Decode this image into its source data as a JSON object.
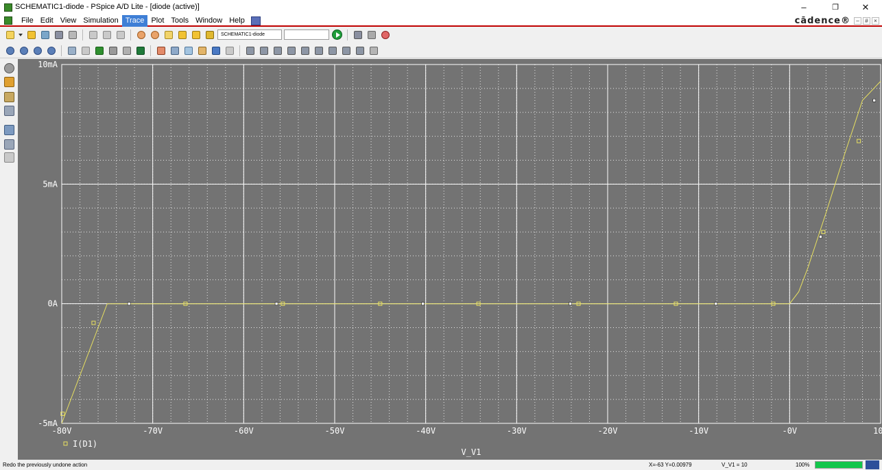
{
  "window": {
    "title": "SCHEMATIC1-diode - PSpice A/D Lite - [diode (active)]",
    "min_label": "–",
    "restore_label": "❐",
    "close_label": "✕"
  },
  "menu": {
    "items": [
      "File",
      "Edit",
      "View",
      "Simulation",
      "Trace",
      "Plot",
      "Tools",
      "Window",
      "Help"
    ],
    "active": "Trace",
    "brand": "cādence®",
    "mdi_min": "–",
    "mdi_restore": "#",
    "mdi_close": "×"
  },
  "toolbar": {
    "profile_value": "SCHEMATIC1-diode",
    "profile_selector_value": ""
  },
  "colors": {
    "plot_bg": "#737373",
    "trace": "#e8e060",
    "grid": "#ffffff",
    "axis_text": "#ffffff",
    "progress": "#12c64b"
  },
  "chart_data": {
    "type": "line",
    "xlabel": "V_V1",
    "ylabel": "",
    "x_ticks": [
      "-80V",
      "-70V",
      "-60V",
      "-50V",
      "-40V",
      "-30V",
      "-20V",
      "-10V",
      "-0V",
      "10V"
    ],
    "y_ticks": [
      "10mA",
      "5mA",
      "0A",
      "-5mA"
    ],
    "xlim": [
      -80,
      10
    ],
    "ylim": [
      -5,
      10
    ],
    "y_unit": "mA",
    "grid": true,
    "legend_position": "bottom-left",
    "series": [
      {
        "name": "I(D1)",
        "x": [
          -80,
          -78,
          -76,
          -75,
          -72,
          -40,
          -10,
          0,
          1,
          2,
          4,
          6,
          8,
          10
        ],
        "y": [
          -5.0,
          -3.0,
          -1.0,
          0,
          0,
          0,
          0,
          0,
          0.5,
          1.5,
          3.8,
          6.2,
          8.5,
          9.3
        ]
      }
    ],
    "markers": {
      "square_x": [
        -79.9,
        -76.5,
        -66.4,
        -55.7,
        -45.0,
        -34.2,
        -23.2,
        -12.5,
        -1.8,
        3.7,
        7.6
      ],
      "square_y": [
        -4.6,
        -0.8,
        0,
        0,
        0,
        0,
        0,
        0,
        0,
        3.0,
        6.8
      ],
      "dot_x": [
        -72.6,
        -56.4,
        -40.3,
        -24.1,
        -8.1,
        3.4,
        9.3
      ],
      "dot_y": [
        0,
        0,
        0,
        0,
        0,
        2.8,
        8.5
      ]
    }
  },
  "status": {
    "message": "Redo the previously undone action",
    "coords": "X=-63  Y=0.00979",
    "v1": "V_V1 = 10",
    "percent": "100%",
    "progress": 1.0
  }
}
